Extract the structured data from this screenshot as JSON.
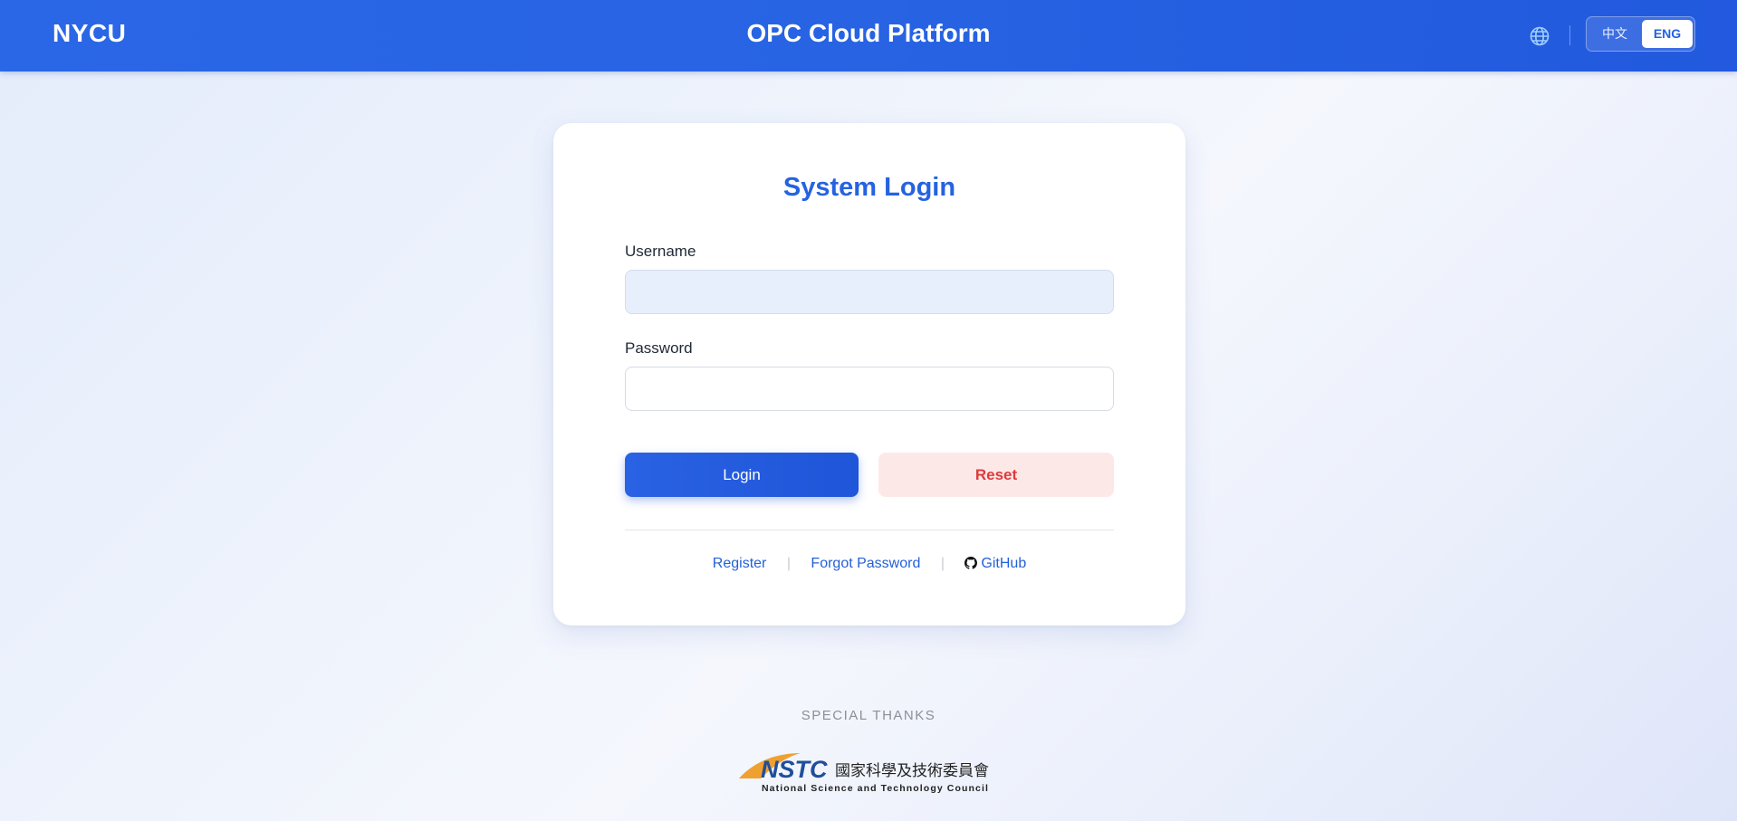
{
  "header": {
    "brand": "NYCU",
    "title": "OPC Cloud Platform",
    "globe_icon": "globe-icon",
    "languages": [
      "中文",
      "ENG"
    ],
    "active_language": "ENG"
  },
  "login": {
    "title": "System Login",
    "username_label": "Username",
    "username_value": "",
    "password_label": "Password",
    "password_value": "",
    "login_button": "Login",
    "reset_button": "Reset"
  },
  "links": {
    "register": "Register",
    "forgot_password": "Forgot Password",
    "github": "GitHub",
    "separator": "|"
  },
  "footer": {
    "thanks_label": "SPECIAL THANKS",
    "sponsor_abbr": "NSTC",
    "sponsor_zh": "國家科學及技術委員會",
    "sponsor_en": "National Science and Technology Council"
  },
  "colors": {
    "accent": "#2563e0",
    "reset_text": "#dc3b3b",
    "reset_bg": "#fde8e8",
    "logo_orange": "#f0a030"
  }
}
